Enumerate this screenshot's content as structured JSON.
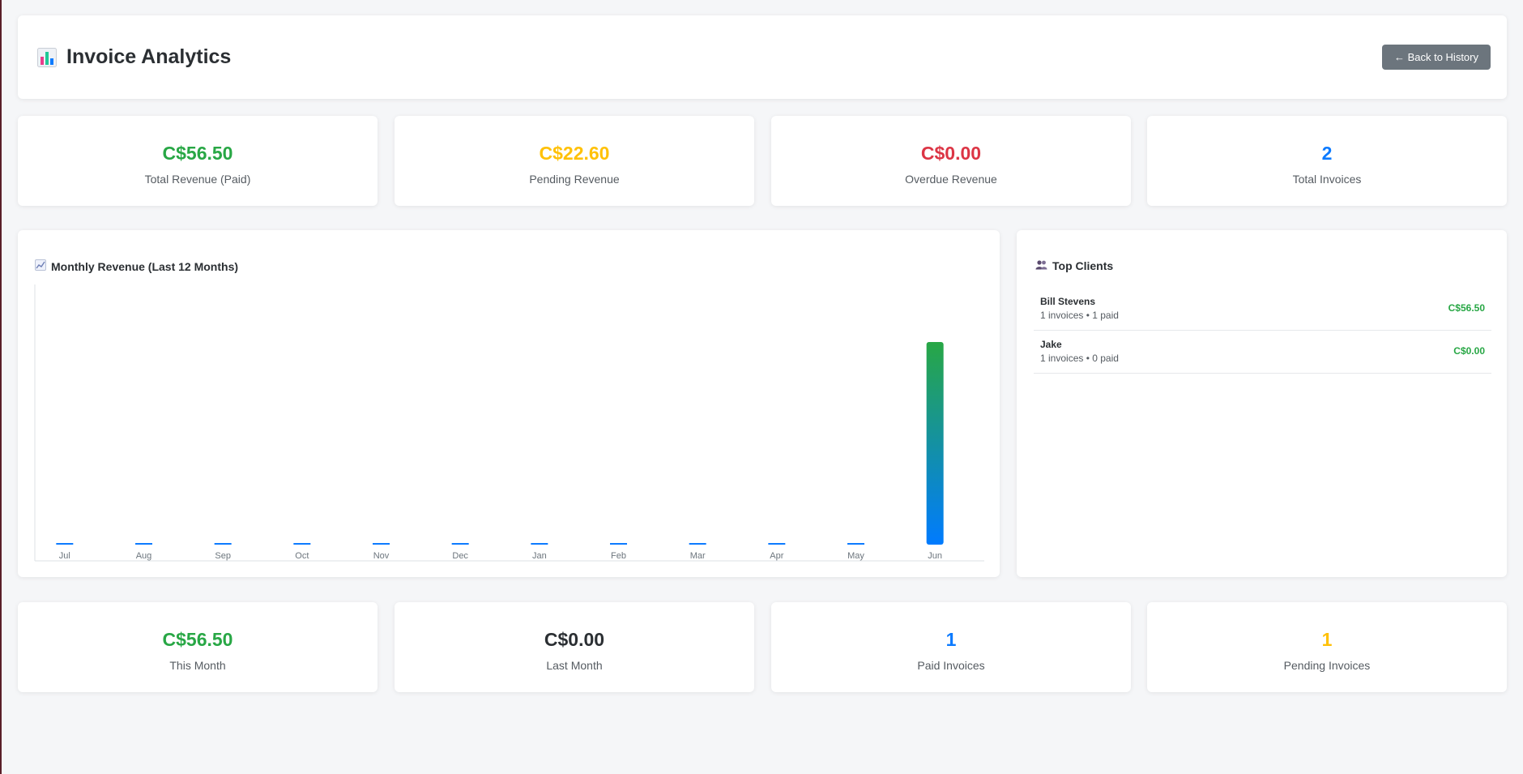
{
  "header": {
    "title": "Invoice Analytics",
    "back_label": "← Back to History"
  },
  "summary": [
    {
      "value": "C$56.50",
      "label": "Total Revenue (Paid)",
      "color": "#28a745"
    },
    {
      "value": "C$22.60",
      "label": "Pending Revenue",
      "color": "#ffc107"
    },
    {
      "value": "C$0.00",
      "label": "Overdue Revenue",
      "color": "#dc3545"
    },
    {
      "value": "2",
      "label": "Total Invoices",
      "color": "#0d7bff"
    }
  ],
  "chart_section": {
    "title": "Monthly Revenue (Last 12 Months)"
  },
  "chart_data": {
    "type": "bar",
    "categories": [
      "Jul",
      "Aug",
      "Sep",
      "Oct",
      "Nov",
      "Dec",
      "Jan",
      "Feb",
      "Mar",
      "Apr",
      "May",
      "Jun"
    ],
    "values": [
      0,
      0,
      0,
      0,
      0,
      0,
      0,
      0,
      0,
      0,
      0,
      56.5
    ],
    "title": "Monthly Revenue (Last 12 Months)",
    "xlabel": "",
    "ylabel": "",
    "grid": false,
    "bar_gradient": [
      "#28a745",
      "#007bff"
    ]
  },
  "clients_section": {
    "title": "Top Clients",
    "clients": [
      {
        "name": "Bill Stevens",
        "meta": "1 invoices • 1 paid",
        "amount": "C$56.50"
      },
      {
        "name": "Jake",
        "meta": "1 invoices • 0 paid",
        "amount": "C$0.00"
      }
    ]
  },
  "monthly": [
    {
      "value": "C$56.50",
      "label": "This Month",
      "color": "#28a745"
    },
    {
      "value": "C$0.00",
      "label": "Last Month",
      "color": "#2b2f33"
    },
    {
      "value": "1",
      "label": "Paid Invoices",
      "color": "#0d7bff"
    },
    {
      "value": "1",
      "label": "Pending Invoices",
      "color": "#ffc107"
    }
  ]
}
